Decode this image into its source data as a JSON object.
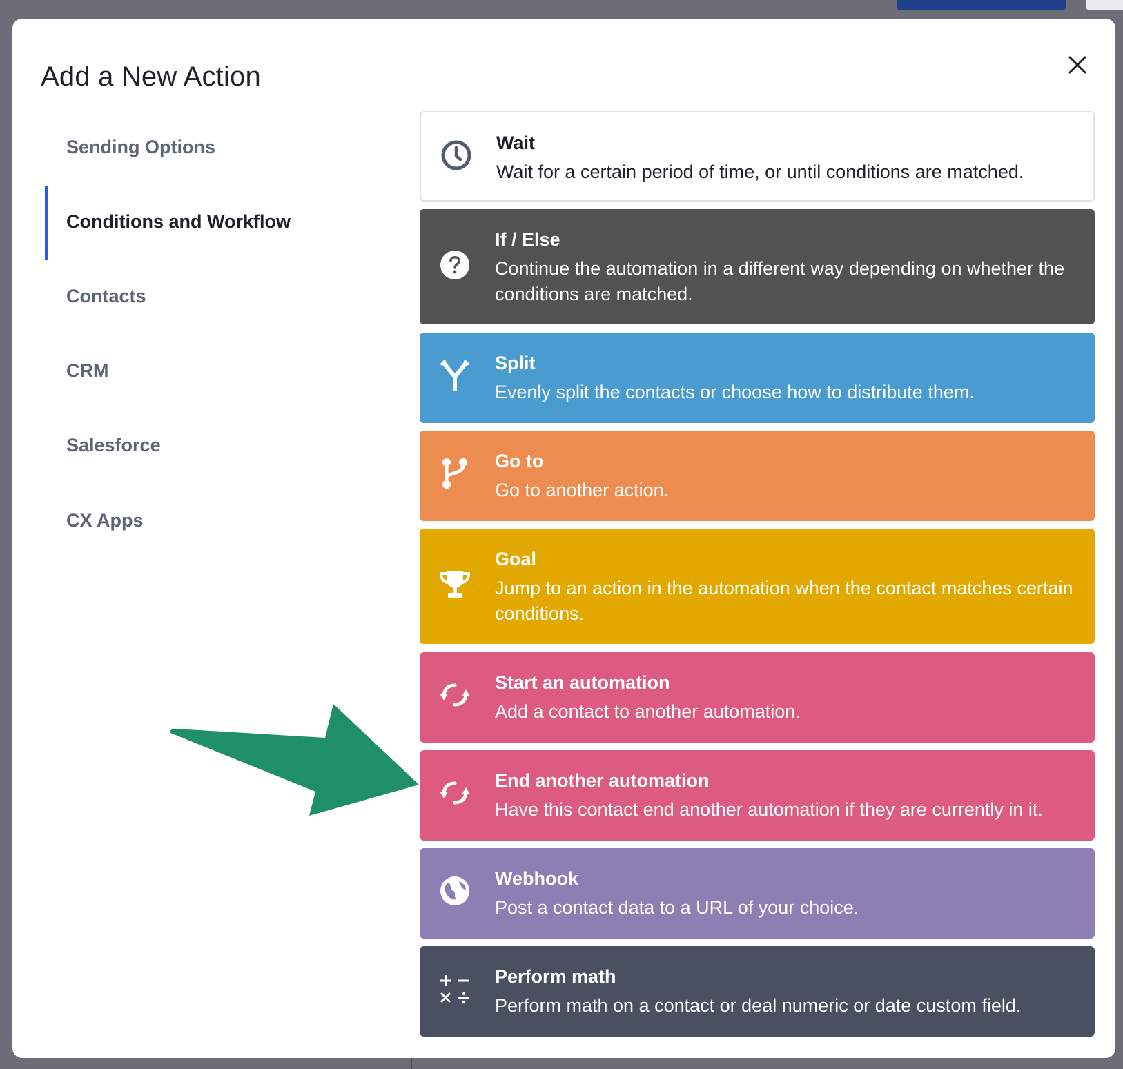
{
  "modal": {
    "title": "Add a New Action"
  },
  "sidebar": {
    "items": [
      {
        "label": "Sending Options",
        "active": false
      },
      {
        "label": "Conditions and Workflow",
        "active": true
      },
      {
        "label": "Contacts",
        "active": false
      },
      {
        "label": "CRM",
        "active": false
      },
      {
        "label": "Salesforce",
        "active": false
      },
      {
        "label": "CX Apps",
        "active": false
      }
    ]
  },
  "actions": [
    {
      "name": "Wait",
      "description": "Wait for a certain period of time, or until conditions are matched.",
      "icon": "clock-icon",
      "color": "#ffffff"
    },
    {
      "name": "If / Else",
      "description": "Continue the automation in a different way depending on whether the conditions are matched.",
      "icon": "question-icon",
      "color": "#525252"
    },
    {
      "name": "Split",
      "description": "Evenly split the contacts or choose how to distribute them.",
      "icon": "split-icon",
      "color": "#4a9bd0"
    },
    {
      "name": "Go to",
      "description": "Go to another action.",
      "icon": "branch-icon",
      "color": "#ec8c51"
    },
    {
      "name": "Goal",
      "description": "Jump to an action in the automation when the contact matches certain conditions.",
      "icon": "trophy-icon",
      "color": "#e3a800"
    },
    {
      "name": "Start an automation",
      "description": "Add a contact to another automation.",
      "icon": "sync-icon",
      "color": "#dd5a80"
    },
    {
      "name": "End another automation",
      "description": "Have this contact end another automation if they are currently in it.",
      "icon": "sync-icon",
      "color": "#dd5a80"
    },
    {
      "name": "Webhook",
      "description": "Post a contact data to a URL of your choice.",
      "icon": "globe-icon",
      "color": "#8b7fb4"
    },
    {
      "name": "Perform math",
      "description": "Perform math on a contact or deal numeric or date custom field.",
      "icon": "math-icon",
      "color": "#4a4f62"
    }
  ],
  "annotation": {
    "arrow_color": "#1f8f68"
  }
}
